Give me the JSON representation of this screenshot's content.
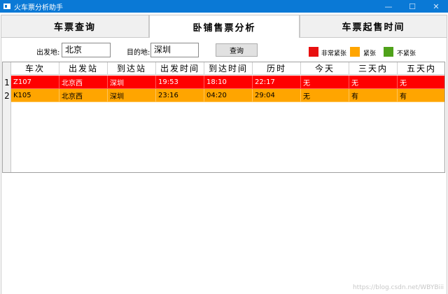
{
  "window": {
    "title": "火车票分析助手",
    "minimize": "—",
    "maximize": "☐",
    "close": "✕"
  },
  "tabs": [
    {
      "label": "车票查询"
    },
    {
      "label": "卧铺售票分析"
    },
    {
      "label": "车票起售时间"
    }
  ],
  "form": {
    "from_label": "出发地:",
    "from_value": "北京",
    "to_label": "目的地:",
    "to_value": "深圳",
    "query_label": "查询"
  },
  "legend": [
    {
      "label": "非常紧张",
      "color": "#e81010"
    },
    {
      "label": "紧张",
      "color": "#ffa500"
    },
    {
      "label": "不紧张",
      "color": "#4fa21a"
    }
  ],
  "table": {
    "columns": [
      "车次",
      "出发站",
      "到达站",
      "出发时间",
      "到达时间",
      "历时",
      "今天",
      "三天内",
      "五天内"
    ],
    "rows": [
      {
        "num": "1",
        "color": "#ff0000",
        "text_color": "#fff",
        "cells": [
          "Z107",
          "北京西",
          "深圳",
          "19:53",
          "18:10",
          "22:17",
          "无",
          "无",
          "无"
        ]
      },
      {
        "num": "2",
        "color": "#ffa500",
        "text_color": "#000",
        "cells": [
          "K105",
          "北京西",
          "深圳",
          "23:16",
          "04:20",
          "29:04",
          "无",
          "有",
          "有"
        ]
      }
    ]
  },
  "watermark": "https://blog.csdn.net/WBYBiii"
}
